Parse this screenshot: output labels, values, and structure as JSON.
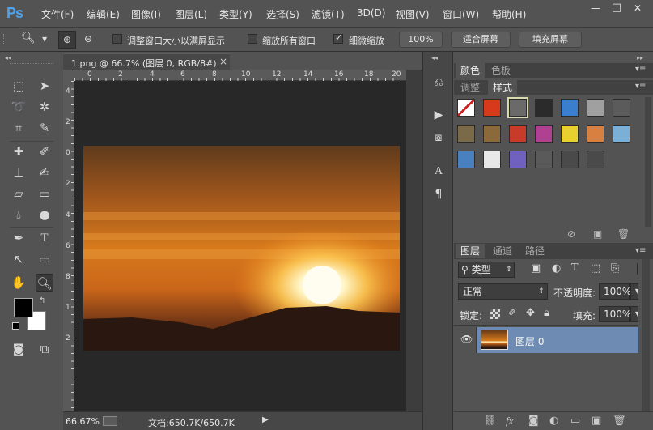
{
  "app": {
    "logo": "Ps"
  },
  "menu": {
    "items": [
      "文件(F)",
      "编辑(E)",
      "图像(I)",
      "图层(L)",
      "类型(Y)",
      "选择(S)",
      "滤镜(T)",
      "3D(D)",
      "视图(V)",
      "窗口(W)",
      "帮助(H)"
    ]
  },
  "window_controls": {
    "minimize": "—",
    "maximize": "□",
    "close": "✕"
  },
  "options": {
    "resize_windows_label": "调整窗口大小以满屏显示",
    "resize_windows_checked": false,
    "zoom_all_label": "缩放所有窗口",
    "zoom_all_checked": false,
    "scrubby_zoom_label": "细微缩放",
    "scrubby_zoom_checked": true,
    "percent_button": "100%",
    "fit_screen_button": "适合屏幕",
    "fill_screen_button": "填充屏幕"
  },
  "document": {
    "tab_title": "1.png @ 66.7% (图层 0, RGB/8#)",
    "tab_close": "×",
    "ruler_top": [
      "0",
      "2",
      "4",
      "6",
      "8",
      "10",
      "12",
      "14",
      "16",
      "18",
      "20"
    ],
    "ruler_left": [
      "4",
      "2",
      "0",
      "2",
      "4",
      "6",
      "8",
      "1",
      "2"
    ],
    "zoom": "66.67%",
    "doc_size": "文档:650.7K/650.7K"
  },
  "color_panel": {
    "tabs": [
      "颜色",
      "色板"
    ],
    "active_tab": "颜色",
    "sub_tabs": [
      "调整",
      "样式"
    ],
    "active_sub_tab": "样式",
    "swatches": [
      [
        "#ffffff",
        "#d63a1a",
        "#6a6a6a",
        "#2b2b2b",
        "#3a7fcf",
        "#a0a0a0",
        "#5b5b5b"
      ],
      [
        "#7a6a4a",
        "#8a6a3a",
        "#c83a2a",
        "#b04090",
        "#e8d030",
        "#d88040",
        "#7ab0d8"
      ],
      [
        "#4a80c0",
        "#e8e8e8",
        "#7060c0",
        "#5a5a5a",
        "#4a4a4a",
        "#4a4a4a"
      ]
    ]
  },
  "layers_panel": {
    "tabs": [
      "图层",
      "通道",
      "路径"
    ],
    "active_tab": "图层",
    "filter_kind": "类型",
    "blend_mode": "正常",
    "opacity_label": "不透明度:",
    "opacity_value": "100%",
    "lock_label": "锁定:",
    "fill_label": "填充:",
    "fill_value": "100%",
    "layer_name": "图层 0"
  },
  "colors": {
    "foreground": "#000000",
    "background": "#ffffff",
    "accent": "#4fa3ea",
    "layer_selected": "#6e8cb3"
  }
}
